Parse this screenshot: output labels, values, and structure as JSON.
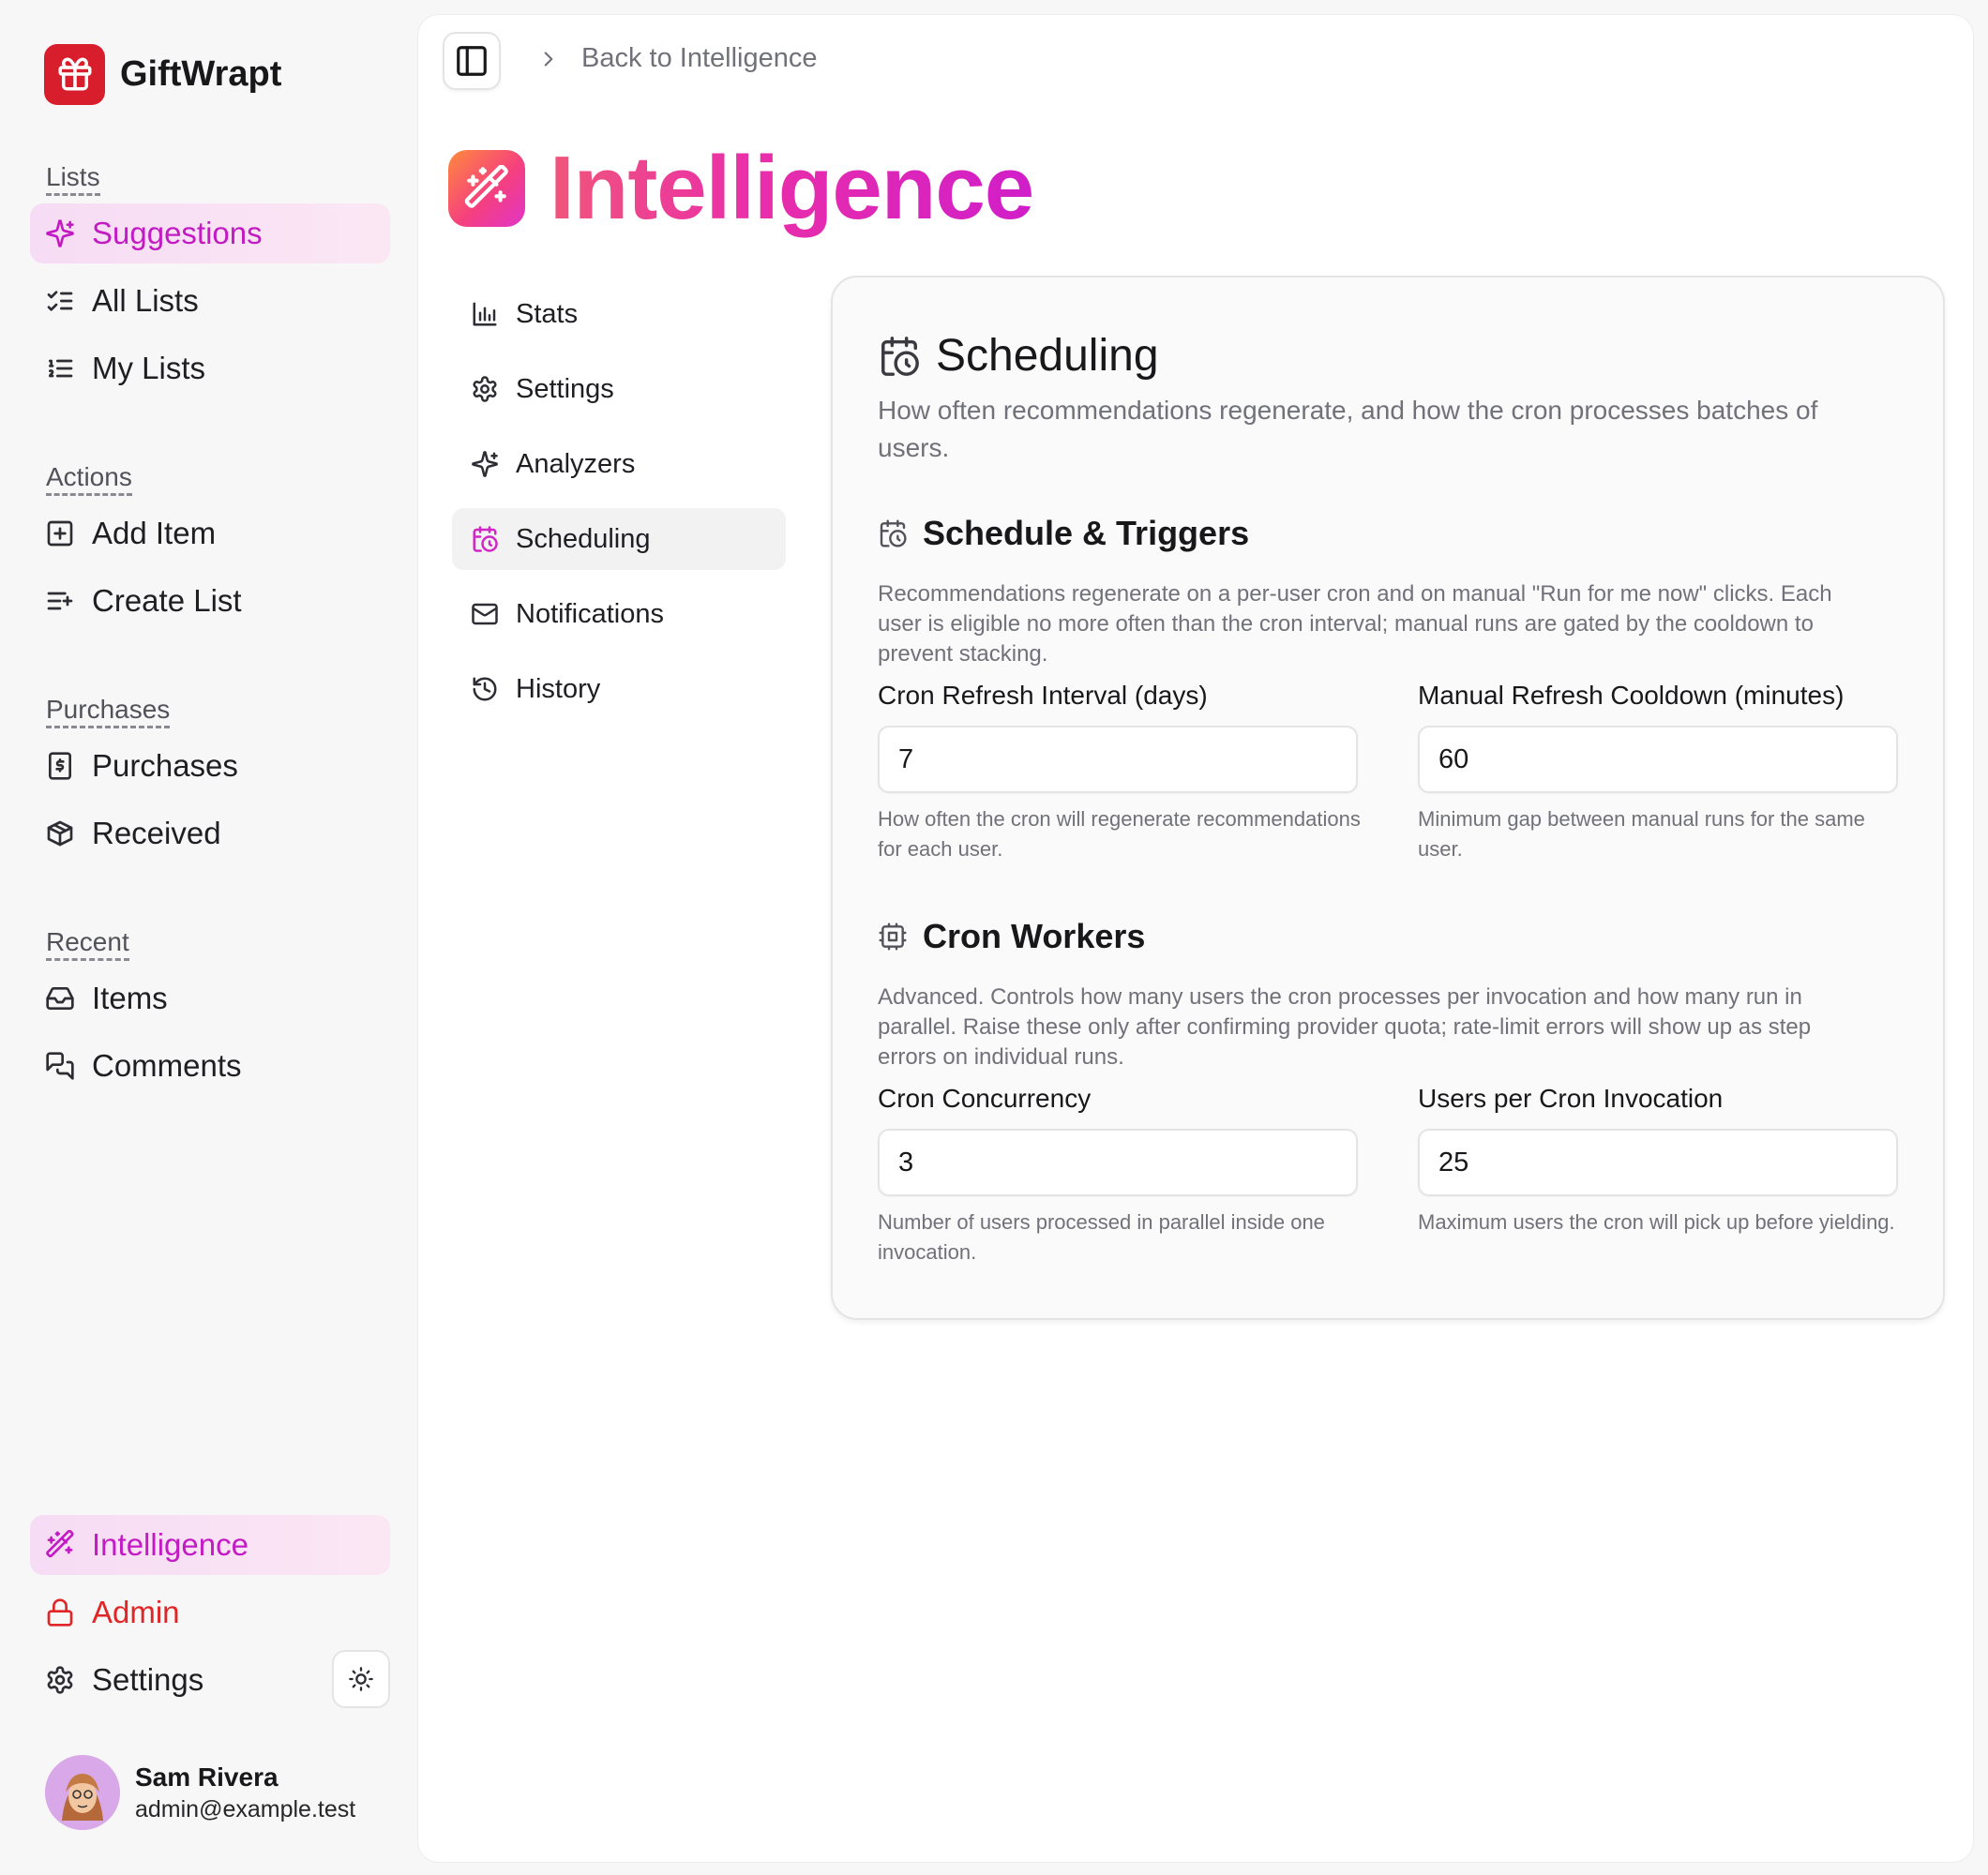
{
  "app": {
    "name": "GiftWrapt",
    "brand_color": "#d81e2d",
    "accent_color": "#c21bc4",
    "danger_color": "#e02626"
  },
  "sidebar": {
    "groups": [
      {
        "label": "Lists",
        "items": [
          {
            "label": "Suggestions",
            "icon": "sparkles-icon",
            "active": true
          },
          {
            "label": "All Lists",
            "icon": "list-checks-icon"
          },
          {
            "label": "My Lists",
            "icon": "list-ordered-icon"
          }
        ]
      },
      {
        "label": "Actions",
        "items": [
          {
            "label": "Add Item",
            "icon": "plus-square-icon"
          },
          {
            "label": "Create List",
            "icon": "list-plus-icon"
          }
        ]
      },
      {
        "label": "Purchases",
        "items": [
          {
            "label": "Purchases",
            "icon": "receipt-icon"
          },
          {
            "label": "Received",
            "icon": "package-icon"
          }
        ]
      },
      {
        "label": "Recent",
        "items": [
          {
            "label": "Items",
            "icon": "inbox-icon"
          },
          {
            "label": "Comments",
            "icon": "messages-icon"
          }
        ]
      }
    ],
    "bottom": {
      "intelligence": "Intelligence",
      "admin": "Admin",
      "settings": "Settings",
      "theme_toggle_icon": "sun-icon"
    },
    "user": {
      "name": "Sam Rivera",
      "email": "admin@example.test"
    }
  },
  "header": {
    "back_link": "Back to Intelligence",
    "toggle_icon": "panel-left-icon"
  },
  "page": {
    "title": "Intelligence",
    "title_icon": "wand-sparkles-icon"
  },
  "subnav": [
    {
      "label": "Stats",
      "icon": "bar-chart-icon"
    },
    {
      "label": "Settings",
      "icon": "gear-icon"
    },
    {
      "label": "Analyzers",
      "icon": "sparkles-icon"
    },
    {
      "label": "Scheduling",
      "icon": "calendar-clock-icon",
      "active": true
    },
    {
      "label": "Notifications",
      "icon": "mail-icon"
    },
    {
      "label": "History",
      "icon": "history-icon"
    }
  ],
  "card": {
    "title": "Scheduling",
    "description": "How often recommendations regenerate, and how the cron processes batches of users.",
    "sections": [
      {
        "title": "Schedule & Triggers",
        "description": "Recommendations regenerate on a per-user cron and on manual \"Run for me now\" clicks. Each user is eligible no more often than the cron interval; manual runs are gated by the cooldown to prevent stacking.",
        "fields": [
          {
            "label": "Cron Refresh Interval (days)",
            "value": "7",
            "help": "How often the cron will regenerate recommendations for each user."
          },
          {
            "label": "Manual Refresh Cooldown (minutes)",
            "value": "60",
            "help": "Minimum gap between manual runs for the same user."
          }
        ]
      },
      {
        "title": "Cron Workers",
        "description": "Advanced. Controls how many users the cron processes per invocation and how many run in parallel. Raise these only after confirming provider quota; rate-limit errors will show up as step errors on individual runs.",
        "fields": [
          {
            "label": "Cron Concurrency",
            "value": "3",
            "help": "Number of users processed in parallel inside one invocation."
          },
          {
            "label": "Users per Cron Invocation",
            "value": "25",
            "help": "Maximum users the cron will pick up before yielding."
          }
        ]
      }
    ]
  }
}
